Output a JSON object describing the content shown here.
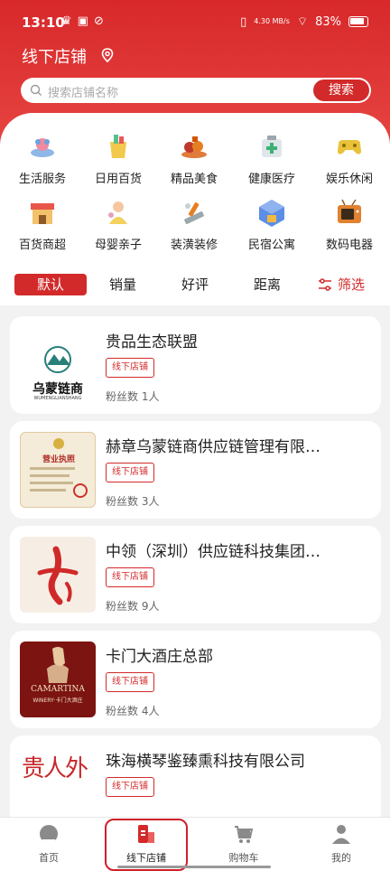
{
  "status_bar": {
    "time": "13:10",
    "net_speed": "4.30 MB/s",
    "battery": "83%"
  },
  "header": {
    "title": "线下店铺",
    "search_placeholder": "搜索店铺名称",
    "search_button": "搜索"
  },
  "categories": [
    {
      "label": "生活服务",
      "icon": "life-service-icon"
    },
    {
      "label": "日用百货",
      "icon": "daily-goods-icon"
    },
    {
      "label": "精品美食",
      "icon": "food-icon"
    },
    {
      "label": "健康医疗",
      "icon": "medical-icon"
    },
    {
      "label": "娱乐休闲",
      "icon": "game-icon"
    },
    {
      "label": "百货商超",
      "icon": "supermarket-icon"
    },
    {
      "label": "母婴亲子",
      "icon": "baby-icon"
    },
    {
      "label": "装潢装修",
      "icon": "tools-icon"
    },
    {
      "label": "民宿公寓",
      "icon": "apartment-icon"
    },
    {
      "label": "数码电器",
      "icon": "tv-icon"
    }
  ],
  "sort": {
    "options": [
      "默认",
      "销量",
      "好评",
      "距离"
    ],
    "active": "默认",
    "filter_label": "筛选"
  },
  "stores": [
    {
      "name": "贵品生态联盟",
      "tag": "线下店铺",
      "fans": "粉丝数 1人",
      "logo_text": "乌蒙链商",
      "logo_sub": "WUMENGLIANSHANG"
    },
    {
      "name": "赫章乌蒙链商供应链管理有限…",
      "tag": "线下店铺",
      "fans": "粉丝数 3人",
      "logo_text": "营业执照"
    },
    {
      "name": "中领（深圳）供应链科技集团…",
      "tag": "线下店铺",
      "fans": "粉丝数 9人"
    },
    {
      "name": "卡门大酒庄总部",
      "tag": "线下店铺",
      "fans": "粉丝数 4人",
      "logo_text": "CAMARTINA",
      "logo_sub": "WINERY·卡门大酒庄"
    },
    {
      "name": "珠海横琴鉴臻熏科技有限公司",
      "tag": "线下店铺",
      "fans": "",
      "logo_text": "贵人外"
    }
  ],
  "bottom_nav": [
    {
      "label": "首页",
      "icon": "home-icon"
    },
    {
      "label": "线下店铺",
      "icon": "store-icon"
    },
    {
      "label": "购物车",
      "icon": "cart-icon"
    },
    {
      "label": "我的",
      "icon": "user-icon"
    }
  ],
  "colors": {
    "brand_red": "#d22a2a"
  }
}
